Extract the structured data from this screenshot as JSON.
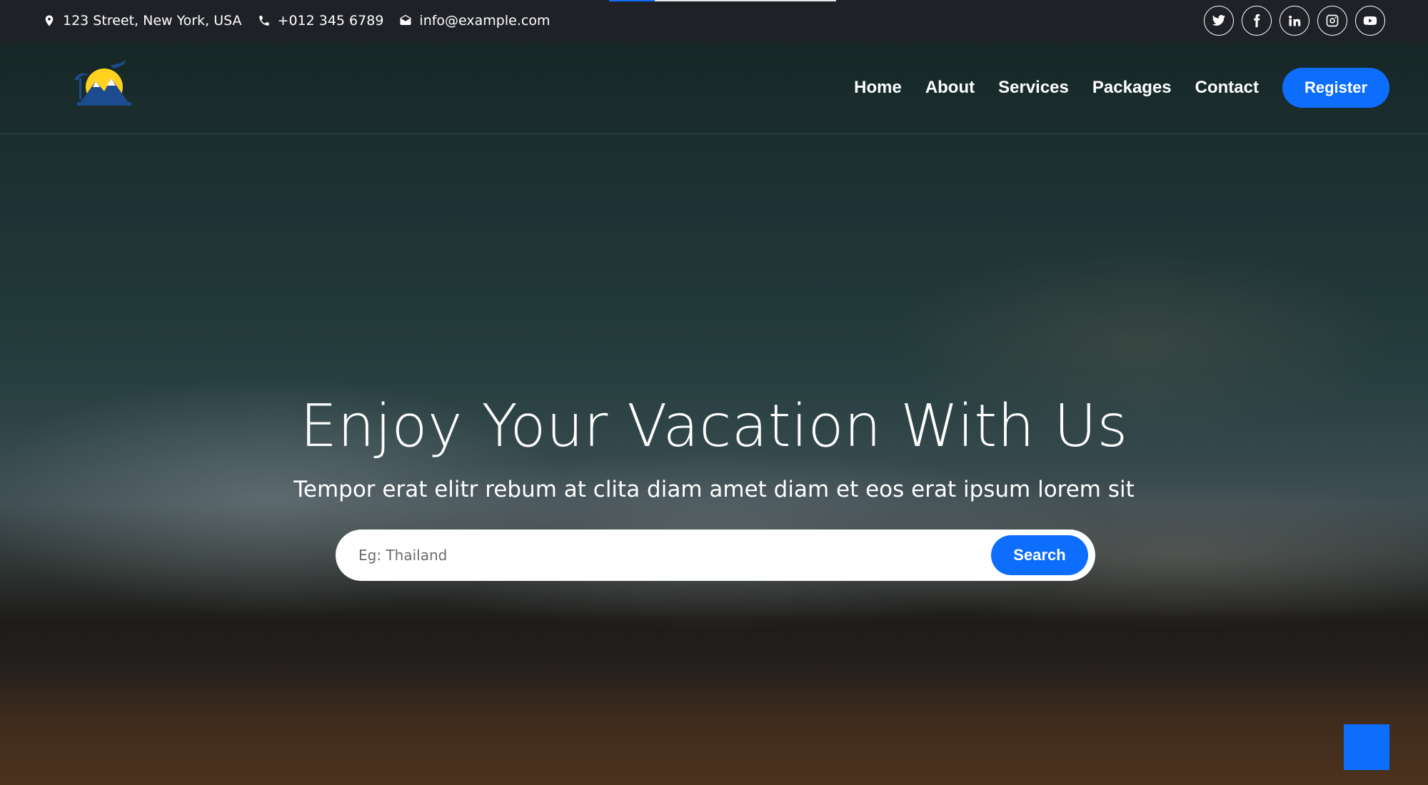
{
  "topbar": {
    "progress": 0.2,
    "address": "123 Street, New York, USA",
    "phone": "+012 345 6789",
    "email": "info@example.com",
    "social": [
      {
        "name": "twitter-icon"
      },
      {
        "name": "facebook-icon"
      },
      {
        "name": "linkedin-icon"
      },
      {
        "name": "instagram-icon"
      },
      {
        "name": "youtube-icon"
      }
    ]
  },
  "navbar": {
    "links": [
      "Home",
      "About",
      "Services",
      "Packages",
      "Contact"
    ],
    "register": "Register"
  },
  "hero": {
    "title": "Enjoy Your Vacation With Us",
    "subtitle": "Tempor erat elitr rebum at clita diam amet diam et eos erat ipsum lorem sit",
    "search_placeholder": "Eg: Thailand",
    "search_value": "",
    "search_button": "Search"
  },
  "colors": {
    "accent": "#0d6efd",
    "topbar_bg": "#1f2127",
    "logo_sun": "#ffd21f",
    "logo_mountain": "#1d4b8f"
  }
}
